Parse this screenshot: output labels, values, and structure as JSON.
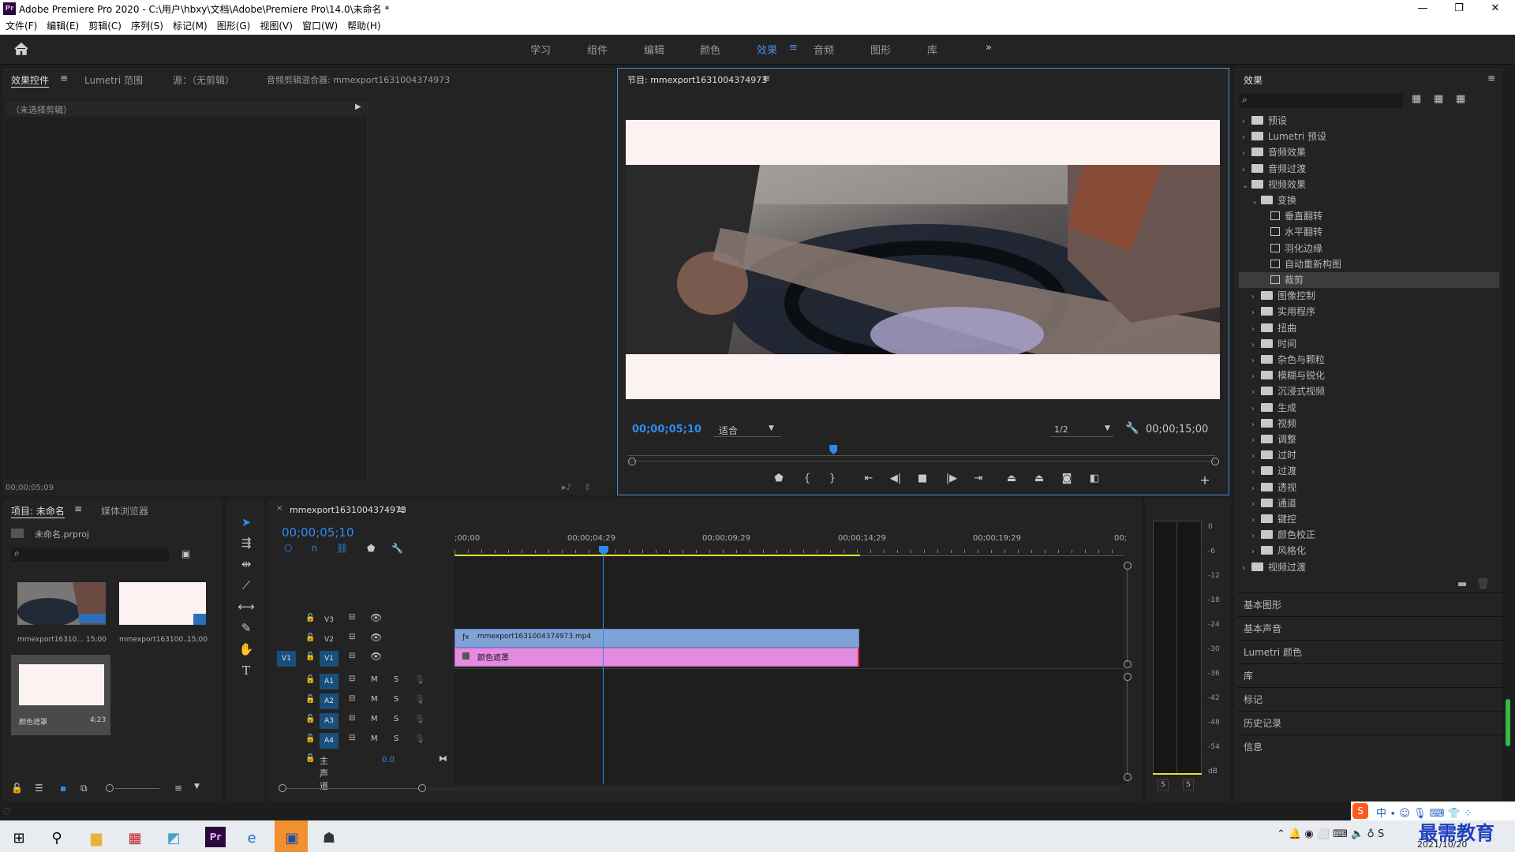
{
  "window": {
    "title": "Adobe Premiere Pro 2020 - C:\\用户\\hbxy\\文档\\Adobe\\Premiere Pro\\14.0\\未命名 *"
  },
  "menu": [
    "文件(F)",
    "编辑(E)",
    "剪辑(C)",
    "序列(S)",
    "标记(M)",
    "图形(G)",
    "视图(V)",
    "窗口(W)",
    "帮助(H)"
  ],
  "workspaces": [
    "学习",
    "组件",
    "编辑",
    "颜色",
    "效果",
    "音频",
    "图形",
    "库"
  ],
  "workspace_active": "效果",
  "source_panel": {
    "tabs": [
      "效果控件",
      "Lumetri 范围",
      "源：（无剪辑）",
      "音频剪辑混合器: mmexport1631004374973"
    ],
    "no_clip": "（未选择剪辑）",
    "timecode": "00;00;05;09"
  },
  "program": {
    "tab": "节目: mmexport1631004374973",
    "timecode": "00;00;05;10",
    "fit": "适合",
    "resolution": "1/2",
    "duration": "00;00;15;00",
    "playhead_fraction": 0.35
  },
  "effects": {
    "title": "效果",
    "tree": [
      {
        "label": "预设",
        "level": 0,
        "type": "folder",
        "open": false
      },
      {
        "label": "Lumetri 预设",
        "level": 0,
        "type": "folder",
        "open": false
      },
      {
        "label": "音频效果",
        "level": 0,
        "type": "folder",
        "open": false
      },
      {
        "label": "音频过渡",
        "level": 0,
        "type": "folder",
        "open": false
      },
      {
        "label": "视频效果",
        "level": 0,
        "type": "folder",
        "open": true
      },
      {
        "label": "变换",
        "level": 1,
        "type": "folder",
        "open": true
      },
      {
        "label": "垂直翻转",
        "level": 2,
        "type": "effect"
      },
      {
        "label": "水平翻转",
        "level": 2,
        "type": "effect"
      },
      {
        "label": "羽化边缘",
        "level": 2,
        "type": "effect"
      },
      {
        "label": "自动重新构图",
        "level": 2,
        "type": "effect"
      },
      {
        "label": "裁剪",
        "level": 2,
        "type": "effect",
        "selected": true
      },
      {
        "label": "图像控制",
        "level": 1,
        "type": "folder",
        "open": false
      },
      {
        "label": "实用程序",
        "level": 1,
        "type": "folder",
        "open": false
      },
      {
        "label": "扭曲",
        "level": 1,
        "type": "folder",
        "open": false
      },
      {
        "label": "时间",
        "level": 1,
        "type": "folder",
        "open": false
      },
      {
        "label": "杂色与颗粒",
        "level": 1,
        "type": "folder",
        "open": false
      },
      {
        "label": "模糊与锐化",
        "level": 1,
        "type": "folder",
        "open": false
      },
      {
        "label": "沉浸式视频",
        "level": 1,
        "type": "folder",
        "open": false
      },
      {
        "label": "生成",
        "level": 1,
        "type": "folder",
        "open": false
      },
      {
        "label": "视频",
        "level": 1,
        "type": "folder",
        "open": false
      },
      {
        "label": "调整",
        "level": 1,
        "type": "folder",
        "open": false
      },
      {
        "label": "过时",
        "level": 1,
        "type": "folder",
        "open": false
      },
      {
        "label": "过渡",
        "level": 1,
        "type": "folder",
        "open": false
      },
      {
        "label": "透视",
        "level": 1,
        "type": "folder",
        "open": false
      },
      {
        "label": "通道",
        "level": 1,
        "type": "folder",
        "open": false
      },
      {
        "label": "键控",
        "level": 1,
        "type": "folder",
        "open": false
      },
      {
        "label": "颜色校正",
        "level": 1,
        "type": "folder",
        "open": false
      },
      {
        "label": "风格化",
        "level": 1,
        "type": "folder",
        "open": false
      },
      {
        "label": "视频过渡",
        "level": 0,
        "type": "folder",
        "open": false
      }
    ],
    "other_panels": [
      "基本图形",
      "基本声音",
      "Lumetri 颜色",
      "库",
      "标记",
      "历史记录",
      "信息"
    ]
  },
  "project": {
    "tabs": [
      "项目: 未命名",
      "媒体浏览器"
    ],
    "file": "未命名.prproj",
    "items": [
      {
        "name": "mmexport16310...",
        "dur": "15;00"
      },
      {
        "name": "mmexport163100...",
        "dur": "15;00"
      },
      {
        "name": "颜色遮罩",
        "dur": "4;23"
      }
    ]
  },
  "timeline": {
    "tab": "mmexport1631004374973",
    "timecode": "00;00;05;10",
    "ruler": [
      ";00;00",
      "00;00;04;29",
      "00;00;09;29",
      "00;00;14;29",
      "00;00;19;29",
      "00;"
    ],
    "video_tracks": [
      "V3",
      "V2",
      "V1"
    ],
    "audio_tracks": [
      "A1",
      "A2",
      "A3",
      "A4"
    ],
    "master": {
      "label": "主声道",
      "value": "0.0"
    },
    "source_patch": "V1",
    "clips": [
      {
        "track": "V2",
        "name": "mmexport1631004374973.mp4",
        "color": "#7fa3d6"
      },
      {
        "track": "V1",
        "name": "颜色遮罩",
        "color": "#e48ae0"
      }
    ],
    "mute_label": "M",
    "solo_label": "S"
  },
  "meter": {
    "scale": [
      "0",
      "-6",
      "-12",
      "-18",
      "-24",
      "-30",
      "-36",
      "-42",
      "-48",
      "-54",
      "dB"
    ],
    "solo": [
      "S",
      "S"
    ]
  },
  "taskbar": {
    "date": "2021/10/20",
    "watermark": "最需教育"
  },
  "colors": {
    "accent": "#4a8ed8",
    "panel": "#232323",
    "timecode": "#2d8ceb"
  }
}
